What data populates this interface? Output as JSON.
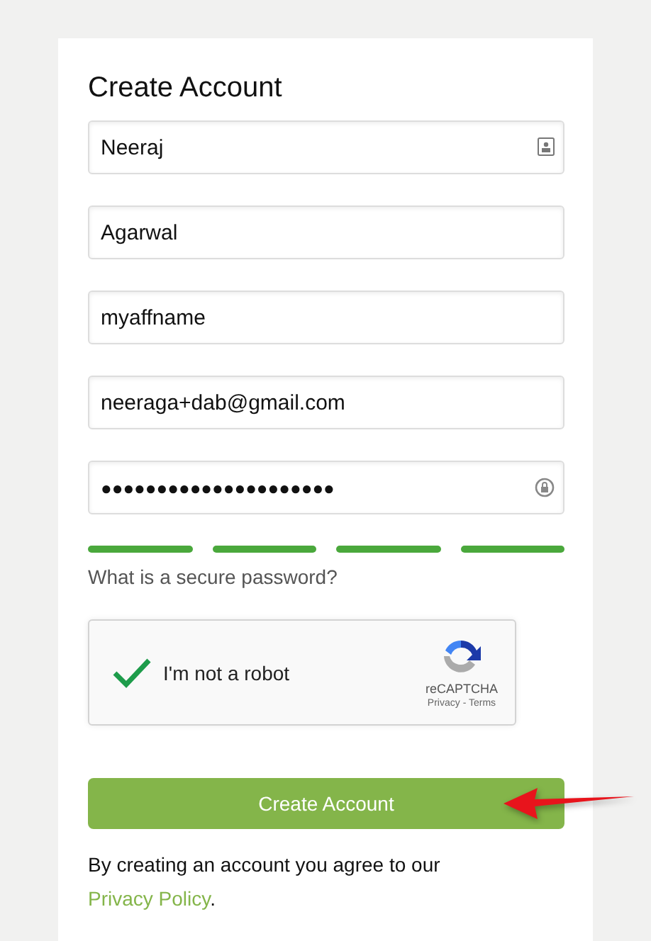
{
  "title": "Create Account",
  "fields": [
    {
      "value": "Neeraj",
      "kind": "contact"
    },
    {
      "value": "Agarwal",
      "kind": "plain"
    },
    {
      "value": "myaffname",
      "kind": "plain"
    },
    {
      "value": "neeraga+dab@gmail.com",
      "kind": "plain"
    },
    {
      "value": "●●●●●●●●●●●●●●●●●●●●●",
      "kind": "password"
    }
  ],
  "strength_segments": [
    {
      "filled": true
    },
    {
      "filled": true
    },
    {
      "filled": true
    },
    {
      "filled": true
    }
  ],
  "password_help_link": "What is a secure password?",
  "captcha": {
    "checked": true,
    "label": "I'm not a robot",
    "brand": "reCAPTCHA",
    "privacy": "Privacy",
    "separator": " - ",
    "terms": "Terms"
  },
  "submit_button": "Create Account",
  "agreement": {
    "text": "By creating an account you agree to our ",
    "link": "Privacy Policy",
    "end": "."
  }
}
